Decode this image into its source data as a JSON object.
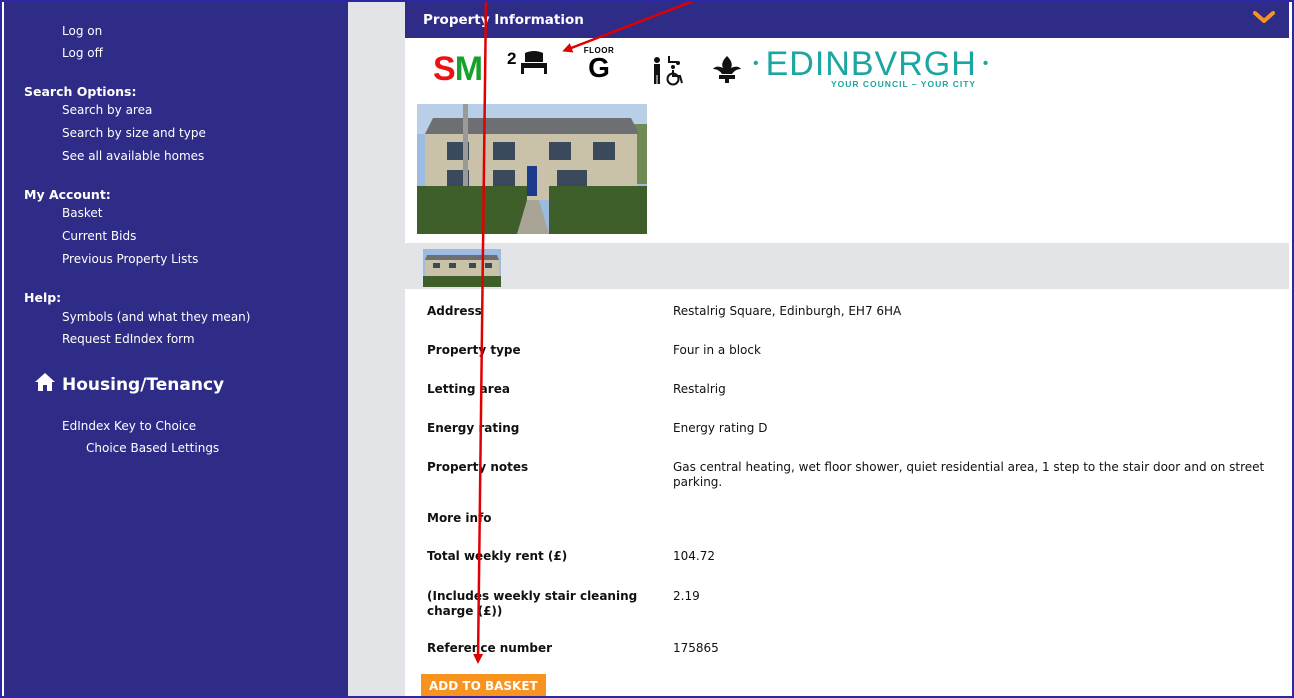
{
  "sidebar": {
    "account_links": [
      {
        "label": "Log on"
      },
      {
        "label": "Log off"
      }
    ],
    "search_options": {
      "heading": "Search Options:",
      "items": [
        {
          "label": "Search by area"
        },
        {
          "label": "Search by size and type"
        },
        {
          "label": "See all available homes"
        }
      ]
    },
    "my_account": {
      "heading": "My Account:",
      "items": [
        {
          "label": "Basket"
        },
        {
          "label": "Current Bids"
        },
        {
          "label": "Previous Property Lists"
        }
      ]
    },
    "help": {
      "heading": "Help:",
      "items": [
        {
          "label": "Symbols (and what they mean)"
        },
        {
          "label": "Request EdIndex form"
        }
      ]
    },
    "housing": {
      "icon": "home-icon",
      "title": "Housing/Tenancy",
      "items": [
        {
          "label": "EdIndex Key to Choice"
        },
        {
          "label": "Choice Based Lettings"
        }
      ]
    }
  },
  "main": {
    "header": {
      "title": "Property Information",
      "collapse_icon": "chevron-down-icon"
    },
    "symbols": {
      "sm_s": "S",
      "sm_m": "M",
      "bedrooms": "2",
      "floor_label": "FLOOR",
      "floor_value": "G",
      "accessibility_icon": "accessible-shower-icon",
      "thistle_icon": "thistle-icon"
    },
    "brand": {
      "name": "EDINBVRGH",
      "tagline": "YOUR COUNCIL – YOUR CITY"
    },
    "details": [
      {
        "label": "Address",
        "value": "Restalrig Square, Edinburgh, EH7 6HA"
      },
      {
        "label": "Property type",
        "value": "Four in a block"
      },
      {
        "label": "Letting area",
        "value": "Restalrig"
      },
      {
        "label": "Energy rating",
        "value": "Energy rating D"
      },
      {
        "label": "Property notes",
        "value": "Gas central heating, wet floor shower, quiet residential area, 1 step to the stair door and on street parking."
      },
      {
        "label": "More info",
        "value": ""
      },
      {
        "label": "Total weekly rent (£)",
        "value": "104.72"
      },
      {
        "label": "(Includes weekly stair cleaning charge (£))",
        "value": "2.19"
      },
      {
        "label": "Reference number",
        "value": "175865"
      }
    ],
    "add_button": "ADD TO BASKET"
  },
  "colors": {
    "sidebar_bg": "#2e2c86",
    "accent_orange": "#f7931e",
    "annotation_red": "#e00000",
    "brand_teal": "#1ba6a1"
  }
}
